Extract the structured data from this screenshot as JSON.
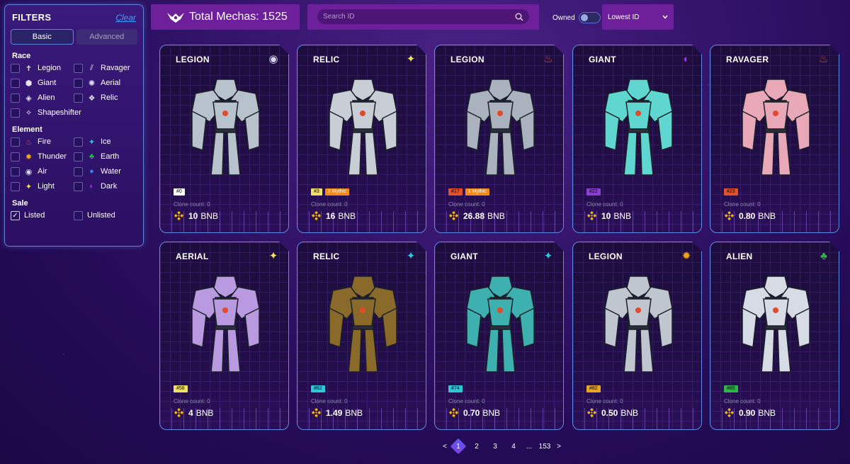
{
  "filters": {
    "title": "FILTERS",
    "clear": "Clear",
    "tabs": {
      "basic": "Basic",
      "advanced": "Advanced"
    },
    "race": {
      "title": "Race",
      "items": [
        {
          "label": "Legion",
          "icon": "legion-icon"
        },
        {
          "label": "Ravager",
          "icon": "ravager-icon"
        },
        {
          "label": "Giant",
          "icon": "giant-icon"
        },
        {
          "label": "Aerial",
          "icon": "aerial-icon"
        },
        {
          "label": "Alien",
          "icon": "alien-icon"
        },
        {
          "label": "Relic",
          "icon": "relic-icon"
        },
        {
          "label": "Shapeshifter",
          "icon": "shapeshifter-icon"
        }
      ]
    },
    "element": {
      "title": "Element",
      "items": [
        {
          "label": "Fire",
          "icon": "fire-icon",
          "color": "#e2512a"
        },
        {
          "label": "Ice",
          "icon": "ice-icon",
          "color": "#2ec8d8"
        },
        {
          "label": "Thunder",
          "icon": "thunder-icon",
          "color": "#e9a623"
        },
        {
          "label": "Earth",
          "icon": "earth-icon",
          "color": "#2fb54a"
        },
        {
          "label": "Air",
          "icon": "air-icon",
          "color": "#d8d8f0"
        },
        {
          "label": "Water",
          "icon": "water-icon",
          "color": "#3a7ee0"
        },
        {
          "label": "Light",
          "icon": "light-icon",
          "color": "#f2e06a"
        },
        {
          "label": "Dark",
          "icon": "dark-icon",
          "color": "#8a3fd0"
        }
      ]
    },
    "sale": {
      "title": "Sale",
      "items": [
        {
          "label": "Listed",
          "checked": true
        },
        {
          "label": "Unlisted",
          "checked": false
        }
      ]
    }
  },
  "header": {
    "total": "Total Mechas: 1525",
    "search_placeholder": "Search ID",
    "owned_label": "Owned",
    "sort": "Lowest ID"
  },
  "cards": [
    {
      "name": "LEGION",
      "id": "#0",
      "tag_color": "#ffffff",
      "mythic": "",
      "clone": "Clone count: 0",
      "price": "10",
      "currency": "BNB",
      "element": "air",
      "el_color": "#d8d8f0",
      "body": "#b8c2cc"
    },
    {
      "name": "RELIC",
      "id": "#3",
      "tag_color": "#f2e06a",
      "mythic": "2 Mythic",
      "clone": "Clone count: 0",
      "price": "16",
      "currency": "BNB",
      "element": "light",
      "el_color": "#f2e06a",
      "body": "#c9ced6"
    },
    {
      "name": "LEGION",
      "id": "#17",
      "tag_color": "#e2512a",
      "mythic": "1 Mythic",
      "clone": "Clone count: 0",
      "price": "26.88",
      "currency": "BNB",
      "element": "fire",
      "el_color": "#e2512a",
      "body": "#aab3bd"
    },
    {
      "name": "GIANT",
      "id": "#22",
      "tag_color": "#8a3fd0",
      "mythic": "",
      "clone": "Clone count: 0",
      "price": "10",
      "currency": "BNB",
      "element": "dark",
      "el_color": "#8a3fd0",
      "body": "#5fd6cf"
    },
    {
      "name": "RAVAGER",
      "id": "#23",
      "tag_color": "#e2512a",
      "mythic": "",
      "clone": "Clone count: 0",
      "price": "0.80",
      "currency": "BNB",
      "element": "fire",
      "el_color": "#e2512a",
      "body": "#e9a8b8"
    },
    {
      "name": "AERIAL",
      "id": "#58",
      "tag_color": "#f2e06a",
      "mythic": "",
      "clone": "Clone count: 0",
      "price": "4",
      "currency": "BNB",
      "element": "light",
      "el_color": "#f2e06a",
      "body": "#b99ae0"
    },
    {
      "name": "RELIC",
      "id": "#62",
      "tag_color": "#2ec8d8",
      "mythic": "",
      "clone": "Clone count: 0",
      "price": "1.49",
      "currency": "BNB",
      "element": "ice",
      "el_color": "#2ec8d8",
      "body": "#8a6a2a"
    },
    {
      "name": "GIANT",
      "id": "#74",
      "tag_color": "#2ec8d8",
      "mythic": "",
      "clone": "Clone count: 0",
      "price": "0.70",
      "currency": "BNB",
      "element": "ice",
      "el_color": "#2ec8d8",
      "body": "#3fb0b0"
    },
    {
      "name": "LEGION",
      "id": "#82",
      "tag_color": "#e9a623",
      "mythic": "",
      "clone": "Clone count: 0",
      "price": "0.50",
      "currency": "BNB",
      "element": "thunder",
      "el_color": "#e9a623",
      "body": "#c0c6d0"
    },
    {
      "name": "ALIEN",
      "id": "#85",
      "tag_color": "#2fb54a",
      "mythic": "",
      "clone": "Clone count: 0",
      "price": "0.90",
      "currency": "BNB",
      "element": "earth",
      "el_color": "#2fb54a",
      "body": "#d6dbe6"
    }
  ],
  "pagination": {
    "prev": "<",
    "pages": [
      "1",
      "2",
      "3",
      "4",
      "...",
      "153"
    ],
    "next": ">",
    "current": "1"
  }
}
